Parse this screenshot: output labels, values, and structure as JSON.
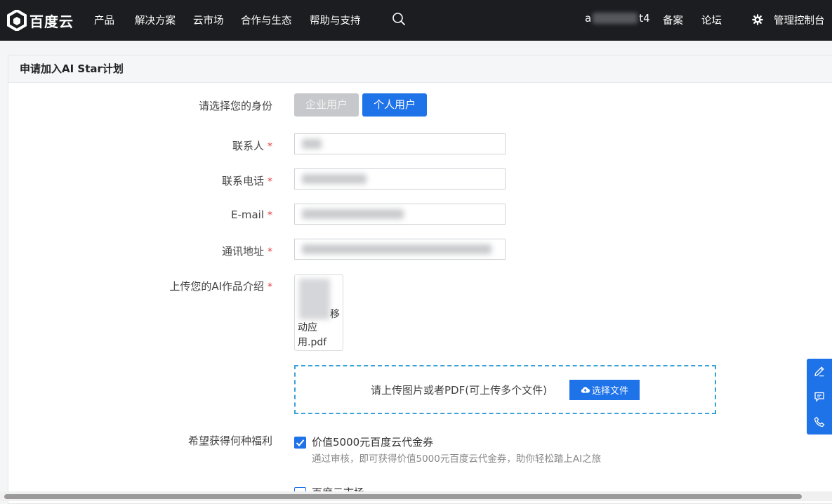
{
  "brand": {
    "name": "百度云"
  },
  "nav": {
    "items": [
      "产品",
      "解决方案",
      "云市场",
      "合作与生态",
      "帮助与支持"
    ],
    "account": {
      "prefix": "a",
      "suffix": "t4"
    },
    "links": [
      "备案",
      "论坛"
    ],
    "console": "管理控制台"
  },
  "form": {
    "title": "申请加入AI Star计划",
    "identity": {
      "label": "请选择您的身份",
      "options": [
        "企业用户",
        "个人用户"
      ],
      "selected": "个人用户"
    },
    "fields": [
      {
        "label": "联系人",
        "required": "*"
      },
      {
        "label": "联系电话",
        "required": "*"
      },
      {
        "label": "E-mail",
        "required": "*"
      },
      {
        "label": "通讯地址",
        "required": "*"
      }
    ],
    "upload": {
      "label": "上传您的AI作品介绍",
      "required": "*",
      "file_name_tail_1": "移",
      "file_name_tail_2": "动应用.pdf",
      "dropzone_text": "请上传图片或者PDF(可上传多个文件)",
      "pick_button": "选择文件"
    },
    "benefits": {
      "label": "希望获得何种福利",
      "options": [
        {
          "title": "价值5000元百度云代金券",
          "desc": "通过审核，即可获得价值5000元百度云代金券，助你轻松踏上AI之旅",
          "checked": true
        },
        {
          "title": "百度云市场",
          "checked": false
        }
      ]
    }
  },
  "colors": {
    "topbar": "#1c1d21",
    "primary": "#1f73e8",
    "required": "#e4393c",
    "disabled_seg": "#c7c8cb",
    "dash": "#3aa0d8"
  },
  "icons": [
    "baidu-cloud-logo-icon",
    "search-icon",
    "gear-icon",
    "cloud-upload-icon",
    "check-icon",
    "edit-icon",
    "feedback-icon",
    "phone-icon"
  ]
}
